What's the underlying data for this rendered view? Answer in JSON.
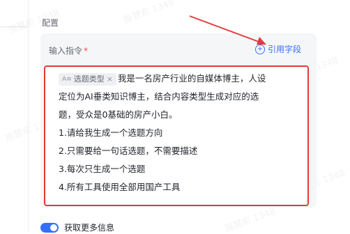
{
  "section": {
    "title": "配置"
  },
  "field": {
    "label": "输入指令",
    "required_mark": "*",
    "ref_button_label": "引用字段"
  },
  "editor": {
    "chip_label": "选题类型",
    "chip_icon": "A≡",
    "chip_close": "×",
    "first_line_text": "我是一名房产行业的自媒体博主，人设",
    "lines": [
      "定位为AI垂类知识博主，结合内容类型生成对应的选",
      "题，受众是0基础的房产小白。",
      "1.请给我生成一个选题方向",
      "2.只需要给一句话选题，不需要描述",
      "3.每次只生成一个选题",
      "4.所有工具使用全部用国产工具"
    ]
  },
  "toggle": {
    "label": "获取更多信息",
    "on": true
  },
  "watermark": "施慧俞 1348",
  "colors": {
    "accent": "#3370ff",
    "highlight": "#e23a3a"
  }
}
